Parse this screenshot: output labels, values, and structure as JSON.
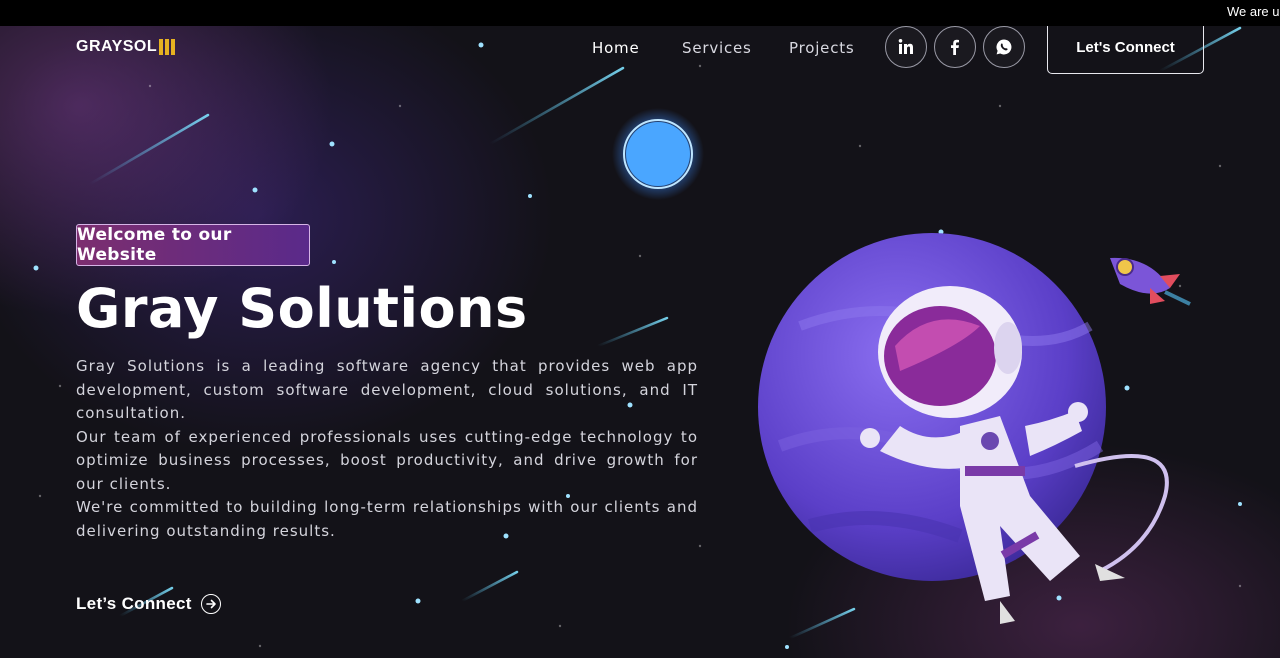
{
  "ticker": {
    "text": "We are u"
  },
  "header": {
    "logo_text": "GRAYSOL",
    "nav": [
      {
        "label": "Home"
      },
      {
        "label": "Services"
      },
      {
        "label": "Projects"
      }
    ],
    "social": [
      {
        "icon": "linkedin-icon"
      },
      {
        "icon": "facebook-icon"
      },
      {
        "icon": "whatsapp-icon"
      }
    ],
    "cta_label": "Let's Connect"
  },
  "hero": {
    "badge": "Welcome to our Website",
    "title": "Gray Solutions",
    "paragraphs": [
      "Gray Solutions is a leading software agency that provides web app development, custom software development, cloud solutions, and IT consultation.",
      "Our team of experienced professionals uses cutting-edge technology to optimize business processes, boost productivity, and drive growth for our clients.",
      "We're committed to building long-term relationships with our clients and delivering outstanding results."
    ],
    "cta_label": "Let’s Connect",
    "cta_icon": "arrow-right-circle-icon"
  },
  "colors": {
    "background": "#131218",
    "logo_accent": "#e6b221",
    "badge_gradient_start": "#7c2e6f",
    "badge_gradient_end": "#5a2a8a",
    "planet": "#6a4ad0"
  }
}
